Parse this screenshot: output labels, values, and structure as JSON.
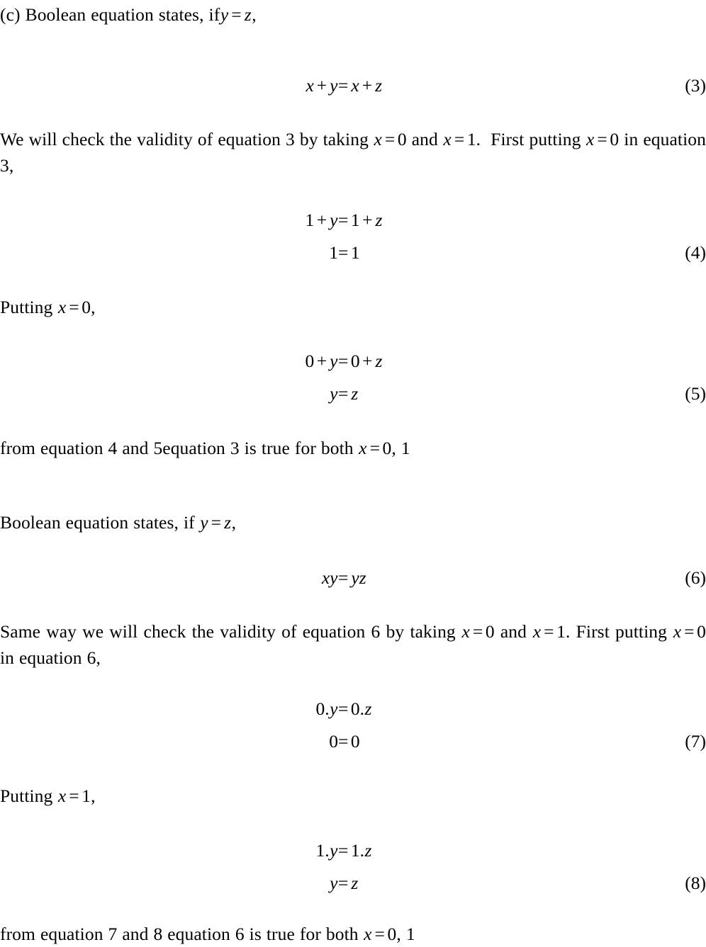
{
  "document": {
    "type": "latex-math-proof",
    "background_color": "#ffffff",
    "text_color": "#000000",
    "blocks": [
      {
        "kind": "paragraph",
        "id": "intro-c",
        "text": "(c) Boolean equation states, if y = z,"
      },
      {
        "kind": "equation",
        "id": "eq3",
        "number": "(3)",
        "lines": [
          {
            "lhs": "x + y",
            "rel": "=",
            "rhs": "x + z"
          }
        ]
      },
      {
        "kind": "paragraph",
        "id": "check-eq3",
        "text": "We will check the validity of equation 3 by taking x = 0 and x = 1. First putting x = 0 in equation 3,"
      },
      {
        "kind": "equation",
        "id": "eq4",
        "number": "(4)",
        "lines": [
          {
            "lhs": "1 + y",
            "rel": "=",
            "rhs": "1 + z"
          },
          {
            "lhs": "1",
            "rel": "=",
            "rhs": "1"
          }
        ]
      },
      {
        "kind": "paragraph",
        "id": "putting-x0",
        "text": "Putting x = 0,"
      },
      {
        "kind": "equation",
        "id": "eq5",
        "number": "(5)",
        "lines": [
          {
            "lhs": "0 + y",
            "rel": "=",
            "rhs": "0 + z"
          },
          {
            "lhs": "y",
            "rel": "=",
            "rhs": "z"
          }
        ]
      },
      {
        "kind": "paragraph",
        "id": "conclusion-1",
        "text": "from equation 4 and 5equation 3 is true for both x = 0, 1"
      },
      {
        "kind": "paragraph",
        "id": "intro-2",
        "text": "Boolean equation states, if y = z,"
      },
      {
        "kind": "equation",
        "id": "eq6",
        "number": "(6)",
        "lines": [
          {
            "lhs": "xy",
            "rel": "=",
            "rhs": "yz"
          }
        ]
      },
      {
        "kind": "paragraph",
        "id": "check-eq6",
        "text": "Same way we will check the validity of equation 6 by taking x = 0 and x = 1. First putting x = 0 in equation 6,"
      },
      {
        "kind": "equation",
        "id": "eq7",
        "number": "(7)",
        "lines": [
          {
            "lhs": "0.y",
            "rel": "=",
            "rhs": "0.z"
          },
          {
            "lhs": "0",
            "rel": "=",
            "rhs": "0"
          }
        ]
      },
      {
        "kind": "paragraph",
        "id": "putting-x1",
        "text": "Putting x = 1,"
      },
      {
        "kind": "equation",
        "id": "eq8",
        "number": "(8)",
        "lines": [
          {
            "lhs": "1.y",
            "rel": "=",
            "rhs": "1.z"
          },
          {
            "lhs": "y",
            "rel": "=",
            "rhs": "z"
          }
        ]
      },
      {
        "kind": "paragraph",
        "id": "conclusion-2",
        "text": "from equation 7 and 8 equation 6 is true for both x = 0, 1"
      }
    ]
  },
  "text": {
    "intro_c_label": "(c)",
    "intro_c_words_1": "Boolean equation states, if",
    "intro_c_var_y": "y",
    "intro_c_eq": "=",
    "intro_c_var_z": "z",
    "intro_c_comma": ",",
    "check3_part1": "We will check the validity of equation 3 by taking",
    "check3_x1": "x",
    "check3_eq1": "=",
    "check3_val1": "0",
    "check3_and": "and",
    "check3_x2": "x",
    "check3_eq2": "=",
    "check3_val2": "1",
    "check3_period": ".",
    "check3_part2": "First putting",
    "check3_x3": "x",
    "check3_eq3": "=",
    "check3_val3": "0",
    "check3_part3": "in equation 3,",
    "putting_x0_word": "Putting",
    "putting_x0_var": "x",
    "putting_x0_eq": "=",
    "putting_x0_val": "0",
    "putting_x0_comma": ",",
    "concl1_part1": "from equation 4 and 5equation 3 is true for both",
    "concl1_x": "x",
    "concl1_eq": "=",
    "concl1_vals": "0, 1",
    "intro2_words": "Boolean equation states, if",
    "intro2_var_y": "y",
    "intro2_eq": "=",
    "intro2_var_z": "z",
    "intro2_comma": ",",
    "check6_part1": "Same way we will check the validity of equation 6 by taking",
    "check6_x1": "x",
    "check6_eq1": "=",
    "check6_val1": "0",
    "check6_and": "and",
    "check6_x2": "x",
    "check6_eq2": "=",
    "check6_val2": "1",
    "check6_period": ".",
    "check6_part2": "First putting",
    "check6_x3": "x",
    "check6_eq3": "=",
    "check6_val3": "0",
    "check6_part3": "in equation 6,",
    "putting_x1_word": "Putting",
    "putting_x1_var": "x",
    "putting_x1_eq": "=",
    "putting_x1_val": "1",
    "putting_x1_comma": ",",
    "concl2_part1": "from equation 7 and 8 equation 6 is true for both",
    "concl2_x": "x",
    "concl2_eq": "=",
    "concl2_vals": "0, 1"
  },
  "equations": {
    "eq3": {
      "number": "(3)",
      "l1_lhs_a": "x",
      "l1_plus": "+",
      "l1_lhs_b": "y",
      "l1_rel": "=",
      "l1_rhs_a": "x",
      "l1_plus2": "+",
      "l1_rhs_b": "z"
    },
    "eq4": {
      "number": "(4)",
      "l1_lhs_a": "1",
      "l1_plus": "+",
      "l1_lhs_b": "y",
      "l1_rel": "=",
      "l1_rhs_a": "1",
      "l1_plus2": "+",
      "l1_rhs_b": "z",
      "l2_lhs": "1",
      "l2_rel": "=",
      "l2_rhs": "1"
    },
    "eq5": {
      "number": "(5)",
      "l1_lhs_a": "0",
      "l1_plus": "+",
      "l1_lhs_b": "y",
      "l1_rel": "=",
      "l1_rhs_a": "0",
      "l1_plus2": "+",
      "l1_rhs_b": "z",
      "l2_lhs": "y",
      "l2_rel": "=",
      "l2_rhs": "z"
    },
    "eq6": {
      "number": "(6)",
      "l1_lhs": "xy",
      "l1_rel": "=",
      "l1_rhs": "yz"
    },
    "eq7": {
      "number": "(7)",
      "l1_lhs_num": "0",
      "l1_lhs_dot": ".",
      "l1_lhs_var": "y",
      "l1_rel": "=",
      "l1_rhs_num": "0",
      "l1_rhs_dot": ".",
      "l1_rhs_var": "z",
      "l2_lhs": "0",
      "l2_rel": "=",
      "l2_rhs": "0"
    },
    "eq8": {
      "number": "(8)",
      "l1_lhs_num": "1",
      "l1_lhs_dot": ".",
      "l1_lhs_var": "y",
      "l1_rel": "=",
      "l1_rhs_num": "1",
      "l1_rhs_dot": ".",
      "l1_rhs_var": "z",
      "l2_lhs": "y",
      "l2_rel": "=",
      "l2_rhs": "z"
    }
  }
}
